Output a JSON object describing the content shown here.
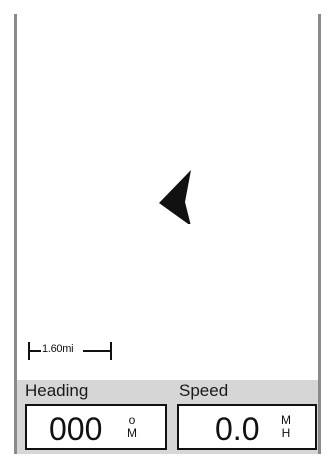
{
  "map": {
    "scale_label": "1.60mi"
  },
  "data_fields": {
    "heading": {
      "label": "Heading",
      "value": "000",
      "unit_top": "o",
      "unit_bottom": "M"
    },
    "speed": {
      "label": "Speed",
      "value": "0.0",
      "unit_top": "M",
      "unit_bottom": "H"
    }
  },
  "icons": {
    "position": "position-arrow-icon"
  },
  "colors": {
    "data_panel": "#d6d6d6",
    "pointer": "#111111"
  }
}
